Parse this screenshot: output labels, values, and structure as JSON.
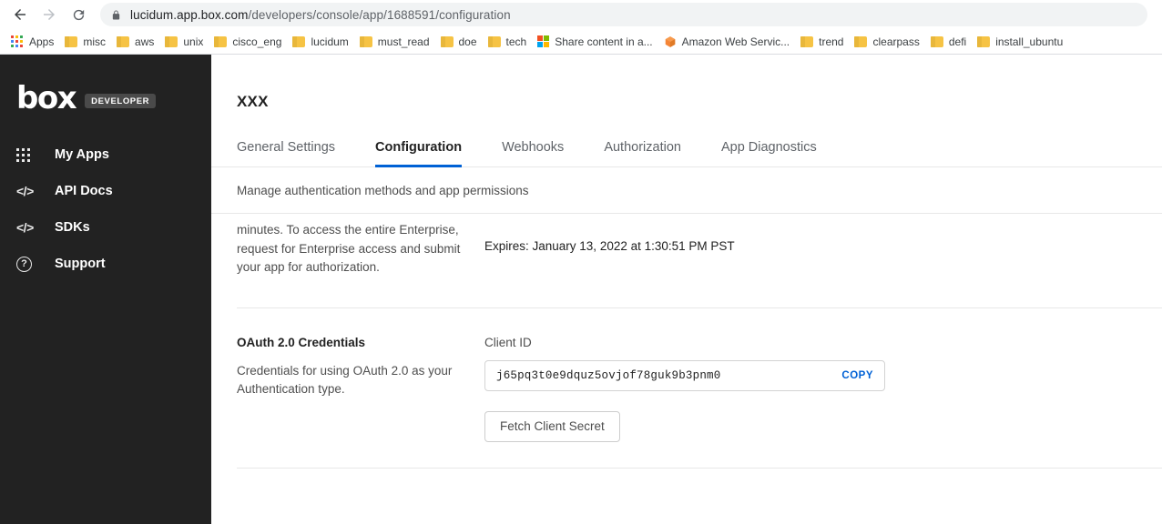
{
  "browser": {
    "back_icon": "arrow-left-icon",
    "forward_icon": "arrow-right-icon",
    "reload_icon": "reload-icon",
    "lock_icon": "lock-icon",
    "url_host": "lucidum.app.box.com",
    "url_path": "/developers/console/app/1688591/configuration",
    "url_full": "lucidum.app.box.com/developers/console/app/1688591/configuration",
    "bookmarks": [
      {
        "label": "Apps",
        "icon": "apps-grid-icon"
      },
      {
        "label": "misc",
        "icon": "folder-icon"
      },
      {
        "label": "aws",
        "icon": "folder-icon"
      },
      {
        "label": "unix",
        "icon": "folder-icon"
      },
      {
        "label": "cisco_eng",
        "icon": "folder-icon"
      },
      {
        "label": "lucidum",
        "icon": "folder-icon"
      },
      {
        "label": "must_read",
        "icon": "folder-icon"
      },
      {
        "label": "doe",
        "icon": "folder-icon"
      },
      {
        "label": "tech",
        "icon": "folder-icon"
      },
      {
        "label": "Share content in a...",
        "icon": "microsoft-logo-icon"
      },
      {
        "label": "Amazon Web Servic...",
        "icon": "aws-cube-icon"
      },
      {
        "label": "trend",
        "icon": "folder-icon"
      },
      {
        "label": "clearpass",
        "icon": "folder-icon"
      },
      {
        "label": "defi",
        "icon": "folder-icon"
      },
      {
        "label": "install_ubuntu",
        "icon": "folder-icon"
      }
    ]
  },
  "sidebar": {
    "logo_text": "box",
    "badge": "DEVELOPER",
    "items": [
      {
        "label": "My Apps",
        "icon": "grid-icon"
      },
      {
        "label": "API Docs",
        "icon": "code-icon"
      },
      {
        "label": "SDKs",
        "icon": "code-icon"
      },
      {
        "label": "Support",
        "icon": "question-circle-icon"
      }
    ]
  },
  "main": {
    "page_title": "XXX",
    "tabs": [
      {
        "label": "General Settings",
        "active": false
      },
      {
        "label": "Configuration",
        "active": true
      },
      {
        "label": "Webhooks",
        "active": false
      },
      {
        "label": "Authorization",
        "active": false
      },
      {
        "label": "App Diagnostics",
        "active": false
      }
    ],
    "section_subtitle": "Manage authentication methods and app permissions",
    "token_section": {
      "blurb": "minutes. To access the entire Enterprise, request for Enterprise access and submit your app for authorization.",
      "expires": "Expires: January 13, 2022 at 1:30:51 PM PST"
    },
    "oauth_section": {
      "heading": "OAuth 2.0 Credentials",
      "blurb": "Credentials for using OAuth 2.0 as your Authentication type.",
      "client_id_label": "Client ID",
      "client_id_value": "j65pq3t0e9dquz5ovjof78guk9b3pnm0",
      "copy_label": "COPY",
      "fetch_secret_label": "Fetch Client Secret"
    }
  },
  "colors": {
    "accent_blue": "#0061d5",
    "sidebar_bg": "#222222",
    "folder_yellow": "#f6c344"
  }
}
